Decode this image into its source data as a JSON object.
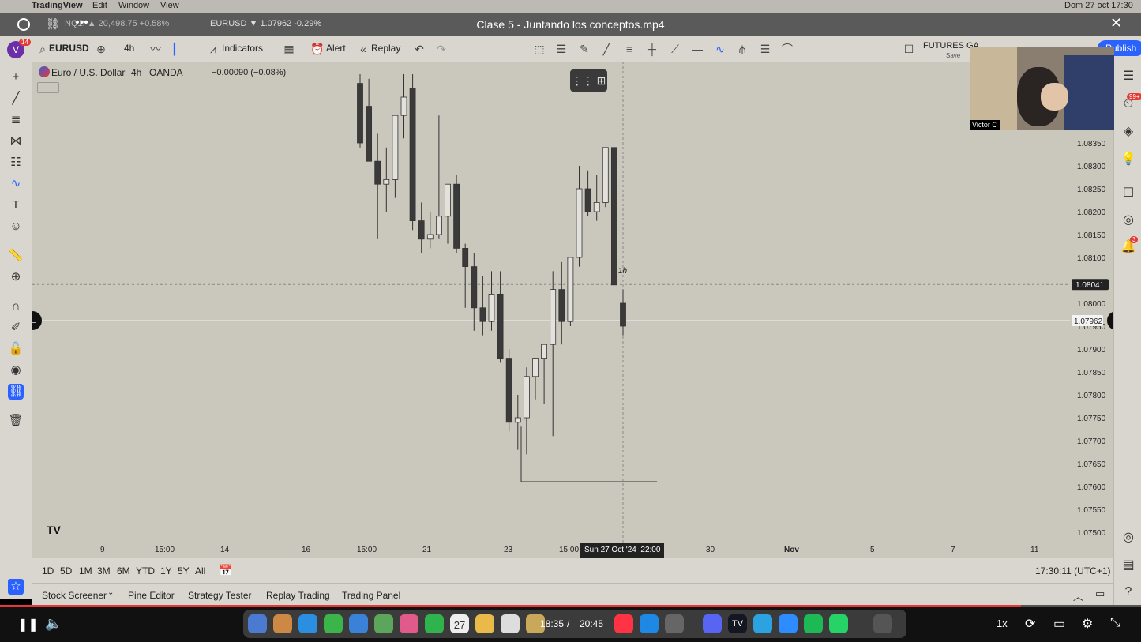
{
  "mac_bar": {
    "app": "TradingView",
    "menu": [
      "Edit",
      "Window",
      "View"
    ],
    "tab1": "NQ1! ▲ 20,498.75 +0.58%",
    "tab2": "EURUSD ▼ 1.07962 -0.29%",
    "datetime": "Dom 27 oct 17:30"
  },
  "video": {
    "title": "Clase 5 - Juntando los conceptos.mp4",
    "current_time": "18:35",
    "separator": "/",
    "total_time": "20:45",
    "progress": 0.895,
    "speed": "1x"
  },
  "toolbar": {
    "symbol": "EURUSD",
    "interval": "4h",
    "indicators_label": "Indicators",
    "alert_label": "Alert",
    "replay_label": "Replay",
    "futures_label": "FUTURES GA",
    "save_label": "Save",
    "publish_label": "Publish",
    "avatar_badge": "14"
  },
  "legend": {
    "title": "Euro / U.S. Dollar",
    "interval": "4h",
    "exchange": "OANDA",
    "change": "−0.00090 (−0.08%)"
  },
  "chart_data": {
    "type": "candlestick",
    "ylim": [
      1.0745,
      1.0849
    ],
    "y_ticks": [
      "1.08350",
      "1.08300",
      "1.08250",
      "1.08200",
      "1.08150",
      "1.08100",
      "1.08000",
      "1.07950",
      "1.07900",
      "1.07850",
      "1.07800",
      "1.07750",
      "1.07700",
      "1.07650",
      "1.07600",
      "1.07550",
      "1.07500"
    ],
    "x_ticks": [
      "9",
      "15:00",
      "14",
      "16",
      "15:00",
      "21",
      "23",
      "15:00",
      "Sun 27 Oct '24",
      "22:00",
      "30",
      "Nov",
      "5",
      "7",
      "11"
    ],
    "crosshair_price": "1.08041",
    "last_price": "1.07962",
    "crosshair_time": "Sun 27 Oct '24",
    "crosshair_time2": "22:00",
    "label_1h": "1h",
    "horizontal_line_price": 1.0761,
    "candles": [
      {
        "o": 1.0848,
        "h": 1.085,
        "l": 1.0834,
        "c": 1.0835
      },
      {
        "o": 1.0843,
        "h": 1.0849,
        "l": 1.0831,
        "c": 1.0831
      },
      {
        "o": 1.0831,
        "h": 1.0837,
        "l": 1.0814,
        "c": 1.0826
      },
      {
        "o": 1.0826,
        "h": 1.0834,
        "l": 1.082,
        "c": 1.0827
      },
      {
        "o": 1.0827,
        "h": 1.0837,
        "l": 1.0823,
        "c": 1.0841
      },
      {
        "o": 1.0841,
        "h": 1.085,
        "l": 1.0836,
        "c": 1.0845
      },
      {
        "o": 1.0847,
        "h": 1.085,
        "l": 1.0816,
        "c": 1.0818
      },
      {
        "o": 1.0818,
        "h": 1.0822,
        "l": 1.0811,
        "c": 1.0814
      },
      {
        "o": 1.0814,
        "h": 1.082,
        "l": 1.0812,
        "c": 1.0815
      },
      {
        "o": 1.0815,
        "h": 1.0841,
        "l": 1.0814,
        "c": 1.0819
      },
      {
        "o": 1.0819,
        "h": 1.0826,
        "l": 1.0813,
        "c": 1.0826
      },
      {
        "o": 1.0826,
        "h": 1.0828,
        "l": 1.0811,
        "c": 1.0812
      },
      {
        "o": 1.0812,
        "h": 1.0813,
        "l": 1.0799,
        "c": 1.0808
      },
      {
        "o": 1.0808,
        "h": 1.0811,
        "l": 1.0794,
        "c": 1.0799
      },
      {
        "o": 1.0799,
        "h": 1.0806,
        "l": 1.0793,
        "c": 1.0796
      },
      {
        "o": 1.0796,
        "h": 1.0807,
        "l": 1.0794,
        "c": 1.0802
      },
      {
        "o": 1.0802,
        "h": 1.0807,
        "l": 1.0787,
        "c": 1.0788
      },
      {
        "o": 1.0788,
        "h": 1.079,
        "l": 1.0772,
        "c": 1.0774
      },
      {
        "o": 1.0774,
        "h": 1.078,
        "l": 1.0768,
        "c": 1.0775
      },
      {
        "o": 1.0775,
        "h": 1.0786,
        "l": 1.0767,
        "c": 1.0784
      },
      {
        "o": 1.0784,
        "h": 1.0788,
        "l": 1.0779,
        "c": 1.0788
      },
      {
        "o": 1.0788,
        "h": 1.079,
        "l": 1.0778,
        "c": 1.0791
      },
      {
        "o": 1.0791,
        "h": 1.0807,
        "l": 1.0771,
        "c": 1.0803
      },
      {
        "o": 1.0803,
        "h": 1.0809,
        "l": 1.0791,
        "c": 1.0796
      },
      {
        "o": 1.0796,
        "h": 1.081,
        "l": 1.0795,
        "c": 1.081
      },
      {
        "o": 1.081,
        "h": 1.083,
        "l": 1.0808,
        "c": 1.0825
      },
      {
        "o": 1.0825,
        "h": 1.0829,
        "l": 1.0819,
        "c": 1.082
      },
      {
        "o": 1.082,
        "h": 1.0828,
        "l": 1.0818,
        "c": 1.0822
      },
      {
        "o": 1.0822,
        "h": 1.0834,
        "l": 1.0821,
        "c": 1.0834
      },
      {
        "o": 1.0834,
        "h": 1.0834,
        "l": 1.0804,
        "c": 1.0804
      },
      {
        "o": 1.08,
        "h": 1.0803,
        "l": 1.0793,
        "c": 1.0795
      }
    ]
  },
  "time_ranges": [
    "1D",
    "5D",
    "1M",
    "3M",
    "6M",
    "YTD",
    "1Y",
    "5Y",
    "All"
  ],
  "clock": "17:30:11 (UTC+1)",
  "bottom_tabs": [
    "Stock Screener",
    "Pine Editor",
    "Strategy Tester",
    "Replay Trading",
    "Trading Panel"
  ],
  "webcam_name": "Victor C",
  "badges": {
    "notifications": "99+",
    "alerts": "3"
  },
  "colors": {
    "chart_bg": "#cac7bd",
    "candle_up": "#e2e1db",
    "candle_down": "#3a3a3a",
    "accent": "#2962ff",
    "progress": "#e53935"
  }
}
